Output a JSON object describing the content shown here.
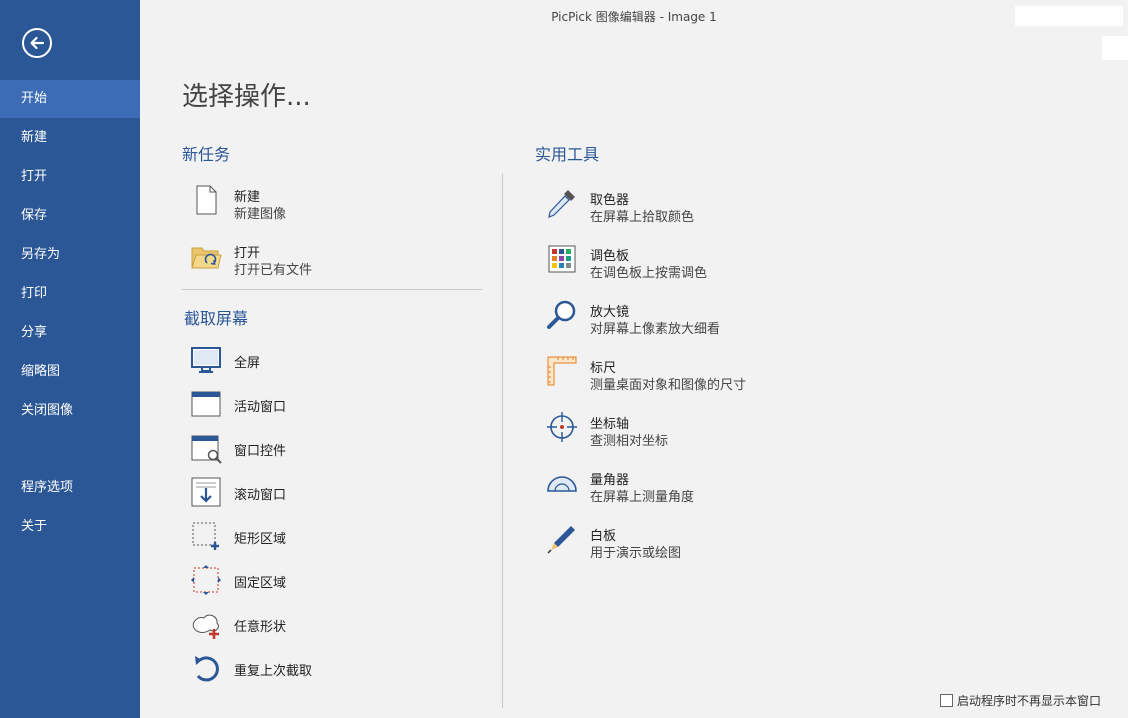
{
  "window": {
    "title": "PicPick 图像编辑器 - Image 1"
  },
  "sidebar": {
    "items": [
      {
        "label": "开始"
      },
      {
        "label": "新建"
      },
      {
        "label": "打开"
      },
      {
        "label": "保存"
      },
      {
        "label": "另存为"
      },
      {
        "label": "打印"
      },
      {
        "label": "分享"
      },
      {
        "label": "缩略图"
      },
      {
        "label": "关闭图像"
      },
      {
        "label": "程序选项"
      },
      {
        "label": "关于"
      }
    ],
    "active": "开始"
  },
  "main": {
    "heading": "选择操作...",
    "new_task": {
      "title": "新任务",
      "items": [
        {
          "title": "新建",
          "desc": "新建图像",
          "icon": "new-file-icon"
        },
        {
          "title": "打开",
          "desc": "打开已有文件",
          "icon": "open-folder-icon"
        }
      ]
    },
    "capture": {
      "title": "截取屏幕",
      "items": [
        {
          "title": "全屏",
          "icon": "monitor-icon"
        },
        {
          "title": "活动窗口",
          "icon": "window-icon"
        },
        {
          "title": "窗口控件",
          "icon": "window-control-icon"
        },
        {
          "title": "滚动窗口",
          "icon": "scroll-window-icon"
        },
        {
          "title": "矩形区域",
          "icon": "rect-region-icon"
        },
        {
          "title": "固定区域",
          "icon": "fixed-region-icon"
        },
        {
          "title": "任意形状",
          "icon": "freeform-icon"
        },
        {
          "title": "重复上次截取",
          "icon": "repeat-icon"
        }
      ]
    },
    "tools": {
      "title": "实用工具",
      "items": [
        {
          "title": "取色器",
          "desc": "在屏幕上拾取颜色",
          "icon": "eyedropper-icon"
        },
        {
          "title": "调色板",
          "desc": "在调色板上按需调色",
          "icon": "palette-icon"
        },
        {
          "title": "放大镜",
          "desc": "对屏幕上像素放大细看",
          "icon": "magnifier-icon"
        },
        {
          "title": "标尺",
          "desc": "测量桌面对象和图像的尺寸",
          "icon": "ruler-icon"
        },
        {
          "title": "坐标轴",
          "desc": "查测相对坐标",
          "icon": "crosshair-icon"
        },
        {
          "title": "量角器",
          "desc": "在屏幕上测量角度",
          "icon": "protractor-icon"
        },
        {
          "title": "白板",
          "desc": "用于演示或绘图",
          "icon": "pen-icon"
        }
      ]
    }
  },
  "footer": {
    "checkbox_label": "启动程序时不再显示本窗口",
    "checked": false
  },
  "colors": {
    "sidebar": "#2b5797",
    "sidebar_active": "#3b6cb5",
    "accent": "#2b5797",
    "background": "#f2f2f2"
  }
}
